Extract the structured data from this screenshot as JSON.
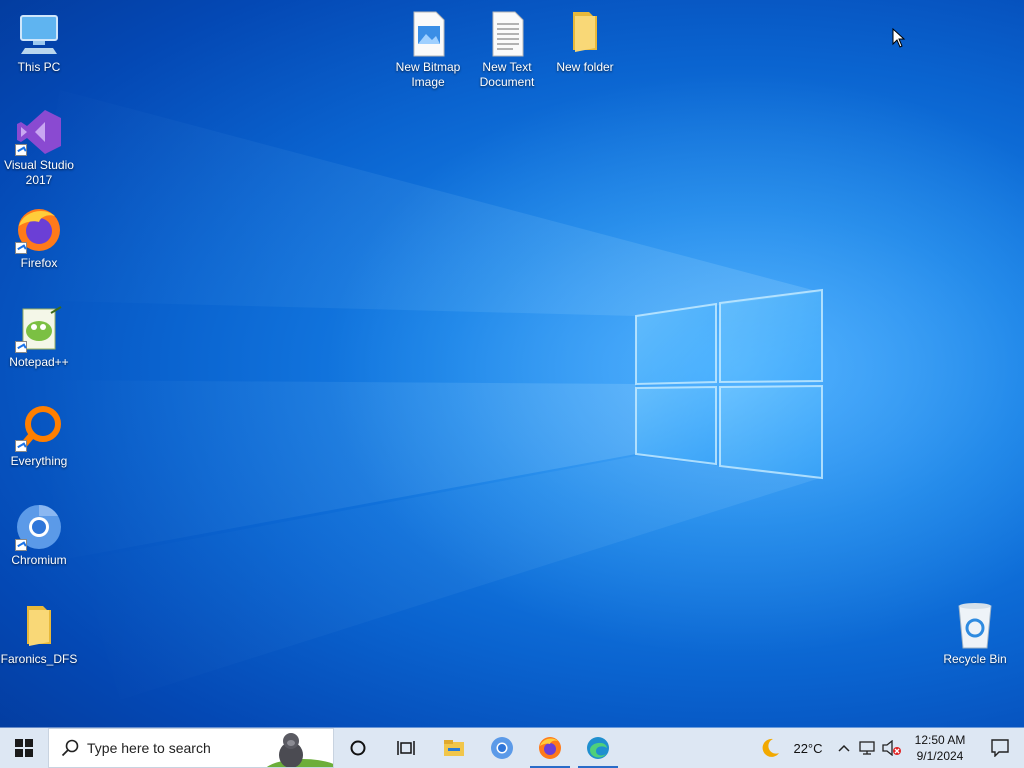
{
  "desktop": {
    "left_icons": [
      {
        "name": "This PC",
        "icon": "computer-icon"
      },
      {
        "name": "Visual Studio 2017",
        "icon": "visual-studio-icon"
      },
      {
        "name": "Firefox",
        "icon": "firefox-icon"
      },
      {
        "name": "Notepad++",
        "icon": "notepadpp-icon"
      },
      {
        "name": "Everything",
        "icon": "everything-search-icon"
      },
      {
        "name": "Chromium",
        "icon": "chromium-icon"
      },
      {
        "name": "Faronics_DFS",
        "icon": "folder-icon"
      }
    ],
    "top_icons": [
      {
        "name": "New Bitmap Image",
        "icon": "bitmap-image-icon"
      },
      {
        "name": "New Text Document",
        "icon": "text-document-icon"
      },
      {
        "name": "New folder",
        "icon": "folder-icon"
      }
    ],
    "recycle_bin": {
      "name": "Recycle Bin",
      "icon": "recycle-bin-icon"
    }
  },
  "taskbar": {
    "search_placeholder": "Type here to search",
    "pinned": [
      "file-explorer-icon",
      "chromium-icon",
      "firefox-icon",
      "edge-icon"
    ],
    "weather": {
      "temp": "22°C",
      "icon": "moon-icon"
    },
    "clock": {
      "time": "12:50 AM",
      "date": "9/1/2024"
    }
  },
  "colors": {
    "accent": "#0a63cf",
    "taskbar_bg": "#dde7f3"
  }
}
